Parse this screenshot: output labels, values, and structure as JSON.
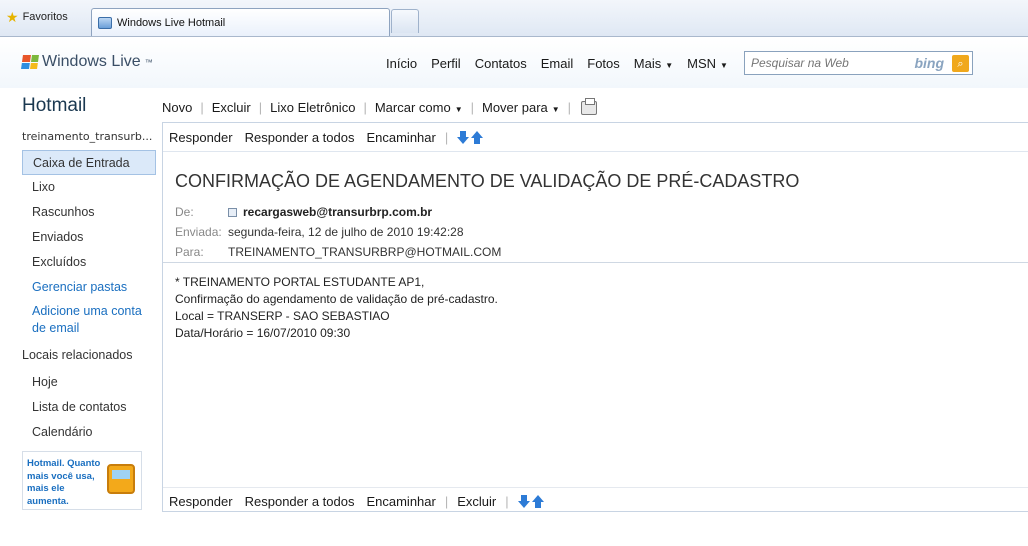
{
  "browser": {
    "favorites_label": "Favoritos",
    "tab_title": "Windows Live Hotmail"
  },
  "header": {
    "logo_text": "Windows Live",
    "logo_tm": "™",
    "nav": [
      "Início",
      "Perfil",
      "Contatos",
      "Email",
      "Fotos",
      "Mais",
      "MSN"
    ],
    "search_placeholder": "Pesquisar na Web",
    "search_brand": "bing"
  },
  "sidebar": {
    "brand": "Hotmail",
    "account": "treinamento_transurb...",
    "folders": [
      "Caixa de Entrada",
      "Lixo",
      "Rascunhos",
      "Enviados",
      "Excluídos"
    ],
    "manage_folders": "Gerenciar pastas",
    "add_account": "Adicione uma conta de email",
    "related_heading": "Locais relacionados",
    "related": [
      "Hoje",
      "Lista de contatos",
      "Calendário"
    ],
    "ad_text": "Hotmail. Quanto mais você usa, mais ele aumenta."
  },
  "toolbar": {
    "new": "Novo",
    "delete": "Excluir",
    "junk": "Lixo Eletrônico",
    "mark_as": "Marcar como",
    "move_to": "Mover para"
  },
  "message_actions": {
    "reply": "Responder",
    "reply_all": "Responder a todos",
    "forward": "Encaminhar",
    "delete": "Excluir"
  },
  "message": {
    "subject": "CONFIRMAÇÃO DE AGENDAMENTO DE VALIDAÇÃO DE PRÉ-CADASTRO",
    "from_label": "De:",
    "from": "recargasweb@transurbrp.com.br",
    "sent_label": "Enviada:",
    "sent": "segunda-feira, 12 de julho de 2010 19:42:28",
    "to_label": "Para:",
    "to": "TREINAMENTO_TRANSURBRP@HOTMAIL.COM",
    "body": [
      "* TREINAMENTO PORTAL ESTUDANTE AP1,",
      "Confirmação do agendamento de validação de pré-cadastro.",
      "Local = TRANSERP - SAO SEBASTIAO",
      "Data/Horário = 16/07/2010 09:30"
    ]
  },
  "colors": {
    "link": "#1a6fc0",
    "selected_folder_bg": "#dbe9f9",
    "search_button": "#f0a81c",
    "arrow_blue": "#2d7bd6"
  }
}
